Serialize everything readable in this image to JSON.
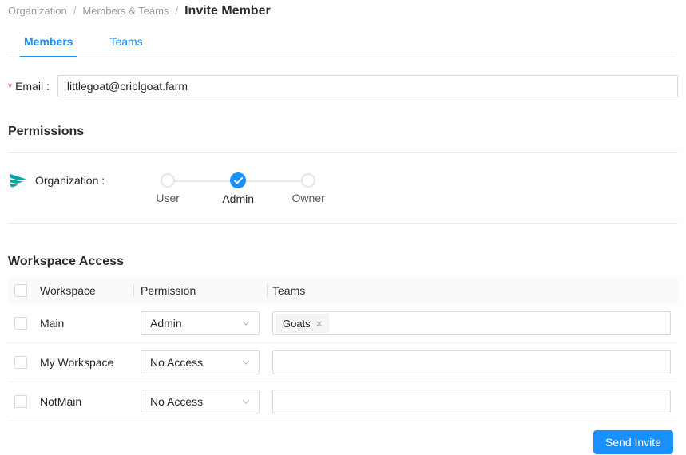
{
  "breadcrumb": {
    "separator": "/",
    "items": [
      "Organization",
      "Members & Teams"
    ],
    "current": "Invite Member"
  },
  "tabs": {
    "members": "Members",
    "teams": "Teams"
  },
  "email": {
    "required_marker": "*",
    "label": "Email :",
    "value": "littlegoat@criblgoat.farm"
  },
  "permissions": {
    "heading": "Permissions",
    "organization": {
      "label": "Organization :",
      "steps": [
        "User",
        "Admin",
        "Owner"
      ],
      "selected": "Admin"
    }
  },
  "workspace_access": {
    "heading": "Workspace Access",
    "columns": [
      "Workspace",
      "Permission",
      "Teams"
    ],
    "rows": [
      {
        "workspace": "Main",
        "permission": "Admin",
        "teams": [
          "Goats"
        ]
      },
      {
        "workspace": "My Workspace",
        "permission": "No Access",
        "teams": []
      },
      {
        "workspace": "NotMain",
        "permission": "No Access",
        "teams": []
      }
    ]
  },
  "icons": {
    "tag_remove": "×"
  },
  "actions": {
    "send_invite": "Send Invite"
  },
  "colors": {
    "primary": "#1890ff",
    "brand_teal": "#00a7a7",
    "required": "#f5222d"
  }
}
